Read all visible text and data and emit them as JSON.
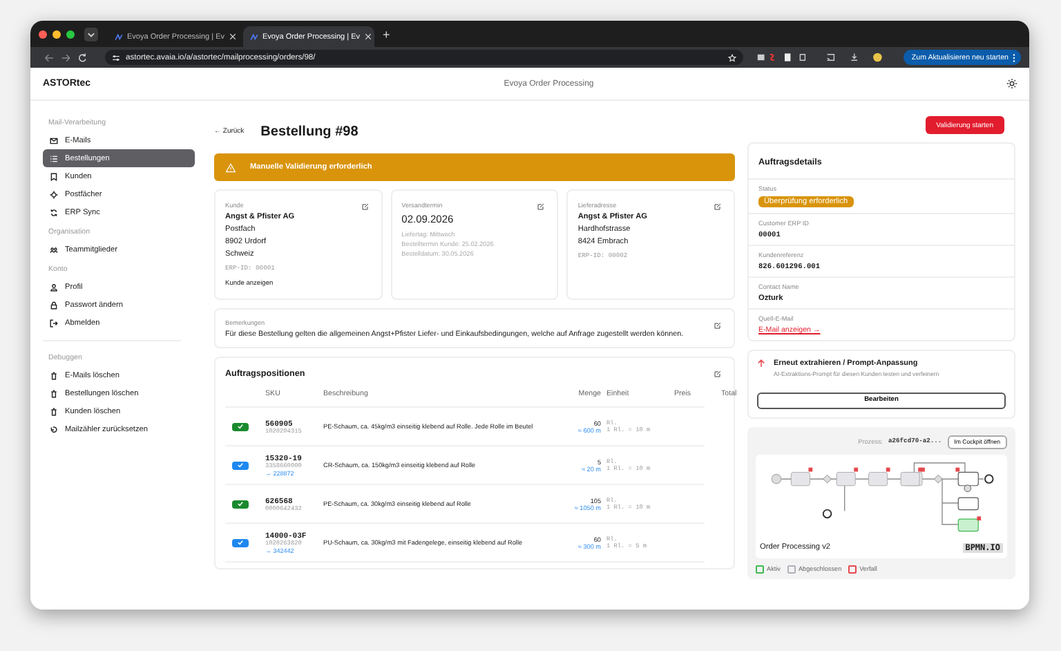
{
  "browser": {
    "tabs": [
      {
        "title": "Evoya Order Processing | Ev",
        "selected": false
      },
      {
        "title": "Evoya Order Processing | Ev",
        "selected": true
      }
    ],
    "new_tab": "+",
    "url": "astortec.avaia.io/a/astortec/mailprocessing/orders/98/",
    "update_button": "Zum Aktualisieren neu starten"
  },
  "header": {
    "brand": "ASTORtec",
    "title": "Evoya Order Processing"
  },
  "sidebar": {
    "sections": [
      {
        "heading": "Mail-Verarbeitung",
        "separated": false,
        "items": [
          {
            "label": "E-Mails",
            "selected": false
          },
          {
            "label": "Bestellungen",
            "selected": true
          },
          {
            "label": "Kunden",
            "selected": false
          },
          {
            "label": "Postfächer",
            "selected": false
          },
          {
            "label": "ERP Sync",
            "selected": false
          }
        ]
      },
      {
        "heading": "Organisation",
        "separated": false,
        "items": [
          {
            "label": "Teammitglieder",
            "selected": false
          }
        ]
      },
      {
        "heading": "Konto",
        "separated": false,
        "items": [
          {
            "label": "Profil",
            "selected": false
          },
          {
            "label": "Passwort ändern",
            "selected": false
          },
          {
            "label": "Abmelden",
            "selected": false
          }
        ]
      },
      {
        "heading": "Debuggen",
        "separated": true,
        "items": [
          {
            "label": "E-Mails löschen",
            "selected": false
          },
          {
            "label": "Bestellungen löschen",
            "selected": false
          },
          {
            "label": "Kunden löschen",
            "selected": false
          },
          {
            "label": "Mailzähler zurücksetzen",
            "selected": false
          }
        ]
      }
    ]
  },
  "main": {
    "back_link": "← Zurück",
    "title": "Bestellung #98",
    "alert": "Manuelle Validierung erforderlich",
    "cards": [
      {
        "kind": "party",
        "label": "Kunde",
        "name": "Angst & Pfister AG",
        "lines": [
          "Postfach",
          "8902 Urdorf",
          "Schweiz"
        ],
        "erp": "ERP-ID: 00001",
        "link": "Kunde anzeigen"
      },
      {
        "kind": "date",
        "label": "Versandtermin",
        "name": "02.09.2026",
        "notes": [
          "Liefertag: Mittwoch",
          "Bestelltermin Kunde: 25.02.2026",
          "Bestelldatum: 30.05.2026"
        ]
      },
      {
        "kind": "party",
        "label": "Lieferadresse",
        "name": "Angst & Pfister AG",
        "lines": [
          "Hardhofstrasse",
          "8424 Embrach"
        ],
        "erp": "ERP-ID: 00002"
      }
    ],
    "remarks": {
      "label": "Bemerkungen",
      "text": "Für diese Bestellung gelten die allgemeinen Angst+Pfister Liefer- und Einkaufsbedingungen, welche auf Anfrage zugestellt werden können."
    },
    "items": {
      "title": "Auftragspositionen",
      "columns": [
        "SKU",
        "Beschreibung",
        "Menge",
        "Einheit",
        "Preis",
        "Total"
      ],
      "rows": [
        {
          "color": "#1a8a2e",
          "sku": "560905",
          "code": "1020204315",
          "description": "PE-Schaum, ca. 45kg/m3 einseitig klebend auf Rolle. Jede Rolle im Beutel",
          "quantity": "60",
          "converted": "≈ 600 m",
          "unit": "Rl.",
          "unit_note": "1 Rl. = 10 m"
        },
        {
          "color": "#1e88f0",
          "sku": "15320-19",
          "code": "3358660000",
          "mapped": "→ 228872",
          "description": "CR-Schaum, ca. 150kg/m3 einseitig klebend auf Rolle",
          "quantity": "5",
          "converted": "≈ 20 m",
          "unit": "Rl.",
          "unit_note": "1 Rl. = 10 m"
        },
        {
          "color": "#1a8a2e",
          "sku": "626568",
          "code": "0000642432",
          "description": "PE-Schaum, ca. 30kg/m3 einseitig klebend auf Rolle",
          "quantity": "105",
          "converted": "≈ 1050 m",
          "unit": "Rl.",
          "unit_note": "1 Rl. = 10 m"
        },
        {
          "color": "#1e88f0",
          "sku": "14000-03F",
          "code": "1020263820",
          "mapped": "→ 342442",
          "description": "PU-Schaum, ca. 30kg/m3 mit Fadengelege, einseitig klebend auf Rolle",
          "quantity": "60",
          "converted": "≈ 300 m",
          "unit": "Rl.",
          "unit_note": "1 Rl. = 5 m"
        }
      ]
    }
  },
  "aside": {
    "validate_button": "Validierung starten",
    "details": {
      "title": "Auftragsdetails",
      "fields": [
        {
          "kind": "badge",
          "label": "Status",
          "value": "Überprüfung erforderlich"
        },
        {
          "kind": "mono",
          "label": "Customer ERP ID",
          "value": "00001"
        },
        {
          "kind": "mono",
          "label": "Kundenreferenz",
          "value": "826.601296.001"
        },
        {
          "kind": "text",
          "label": "Contact Name",
          "value": "Ozturk"
        },
        {
          "kind": "link",
          "label": "Quell-E-Mail",
          "value": "E-Mail anzeigen →"
        }
      ]
    },
    "reextract": {
      "title": "Erneut extrahieren / Prompt-Anpassung",
      "subtitle": "AI-Extraktions-Prompt für diesen Kunden testen und verfeinern",
      "button": "Bearbeiten"
    },
    "process": {
      "label": "Prozess:",
      "id": "a26fcd70-a2...",
      "button": "Im Cockpit öffnen",
      "diagram_title": "Order Processing v2",
      "logo": "BPMN.IO",
      "legend": [
        {
          "label": "Aktiv",
          "color": "#3fb950"
        },
        {
          "label": "Abgeschlossen",
          "color": "#b0b0b8"
        },
        {
          "label": "Verfall",
          "color": "#e5484d"
        }
      ]
    }
  }
}
